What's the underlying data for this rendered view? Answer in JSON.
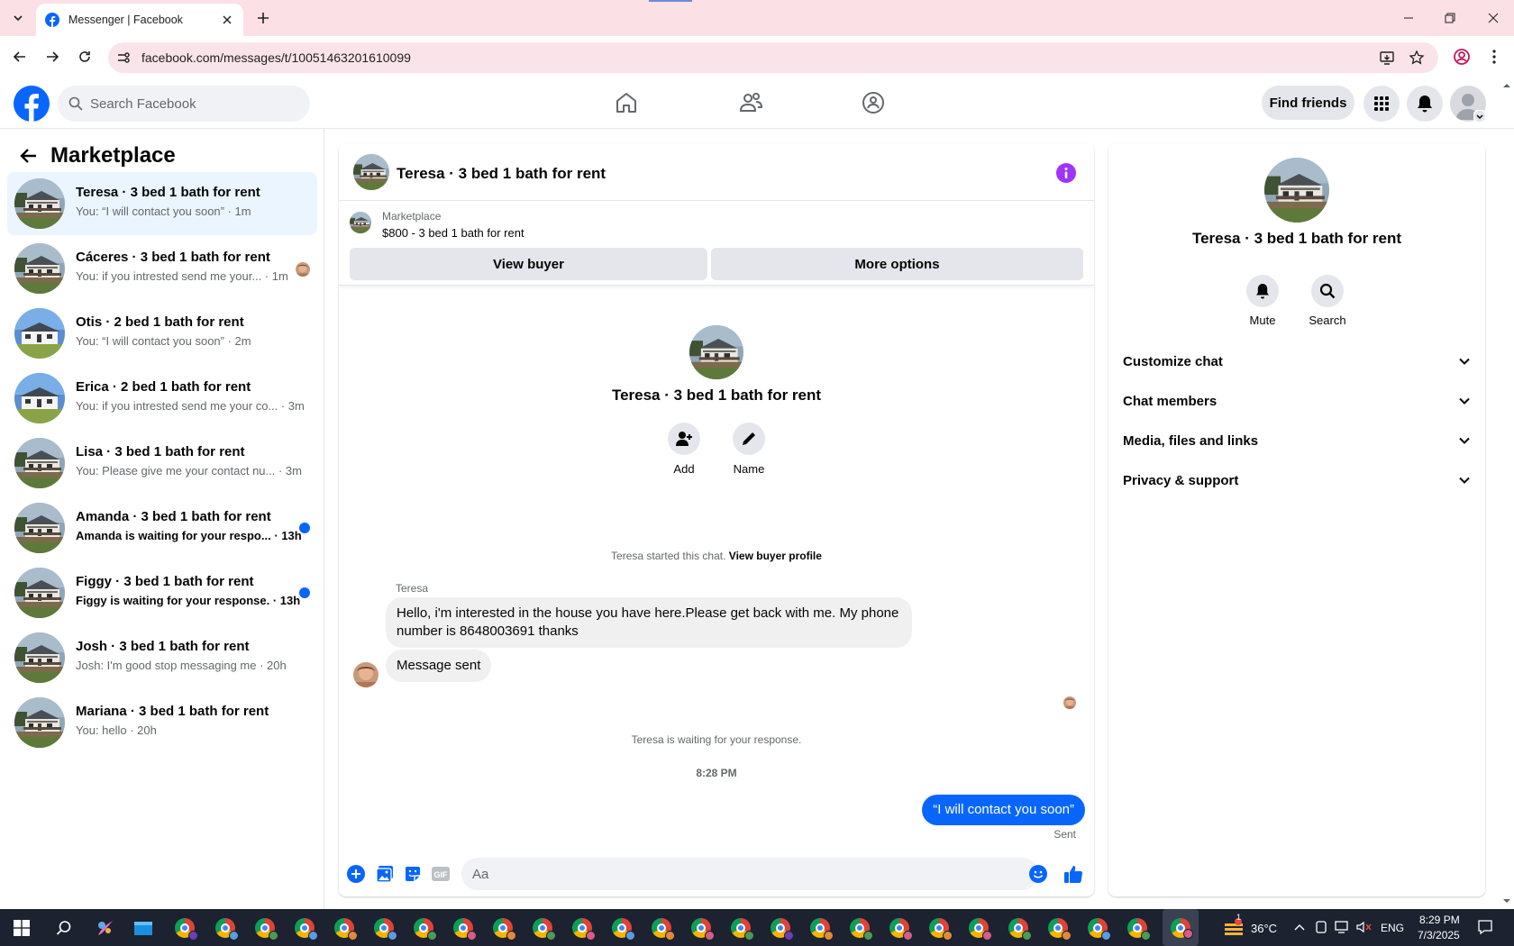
{
  "browser": {
    "tab_title": "Messenger | Facebook",
    "url": "facebook.com/messages/t/10051463201610099"
  },
  "fb": {
    "search_placeholder": "Search Facebook",
    "find_friends": "Find friends"
  },
  "sidebar": {
    "title": "Marketplace",
    "conversations": [
      {
        "name": "Teresa · 3 bed 1 bath for rent",
        "snippet": "You: “I will contact you soon” · 1m",
        "active": true,
        "unread": false
      },
      {
        "name": "Cáceres · 3 bed 1 bath for rent",
        "snippet": "You: if you intrested send me your... · 1m",
        "active": false,
        "unread": false,
        "seen": true
      },
      {
        "name": "Otis · 2 bed 1 bath for rent",
        "snippet": "You: “I will contact you soon” · 2m",
        "active": false,
        "unread": false
      },
      {
        "name": "Erica · 2 bed 1 bath for rent",
        "snippet": "You: if you intrested send me your co... · 3m",
        "active": false,
        "unread": false
      },
      {
        "name": "Lisa · 3 bed 1 bath for rent",
        "snippet": "You: Please give me your contact nu...   · 3m",
        "active": false,
        "unread": false
      },
      {
        "name": "Amanda · 3 bed 1 bath for rent",
        "snippet": "Amanda is waiting for your respo... · 13h",
        "active": false,
        "unread": true
      },
      {
        "name": "Figgy · 3 bed 1 bath for rent",
        "snippet": "Figgy is waiting for your response. · 13h",
        "active": false,
        "unread": true
      },
      {
        "name": "Josh · 3 bed 1 bath for rent",
        "snippet": "Josh: I'm good stop messaging me · 20h",
        "active": false,
        "unread": false
      },
      {
        "name": "Mariana · 3 bed 1 bath for rent",
        "snippet": "You: hello · 20h",
        "active": false,
        "unread": false
      }
    ]
  },
  "chat": {
    "title": "Teresa · 3 bed 1 bath for rent",
    "marketplace_label": "Marketplace",
    "listing": "$800 - 3 bed 1 bath for rent",
    "view_buyer": "View buyer",
    "more_options": "More options",
    "intro_title": "Teresa · 3 bed 1 bath for rent",
    "add_label": "Add",
    "name_label": "Name",
    "started_text": "Teresa started this chat.",
    "view_profile": "View buyer profile",
    "sender": "Teresa",
    "message_1": "Hello, i'm interested in the house you have here.Please get back with me. My phone number is 8648003691 thanks",
    "message_2": "Message sent",
    "waiting_text": "Teresa is waiting for your response.",
    "time": "8:28 PM",
    "outgoing": "“I will contact you soon”",
    "sent_label": "Sent",
    "composer_placeholder": "Aa"
  },
  "info_panel": {
    "title": "Teresa · 3 bed 1 bath for rent",
    "mute": "Mute",
    "search": "Search",
    "sections": [
      "Customize chat",
      "Chat members",
      "Media, files and links",
      "Privacy & support"
    ]
  },
  "taskbar": {
    "weather": "36°C",
    "lang": "ENG",
    "time": "8:29 PM",
    "date": "7/3/2025",
    "notification_count": "1"
  },
  "colors": {
    "fb_blue": "#0866ff",
    "info_purple": "#a033ff",
    "active_conv_bg": "#ebf5ff"
  }
}
